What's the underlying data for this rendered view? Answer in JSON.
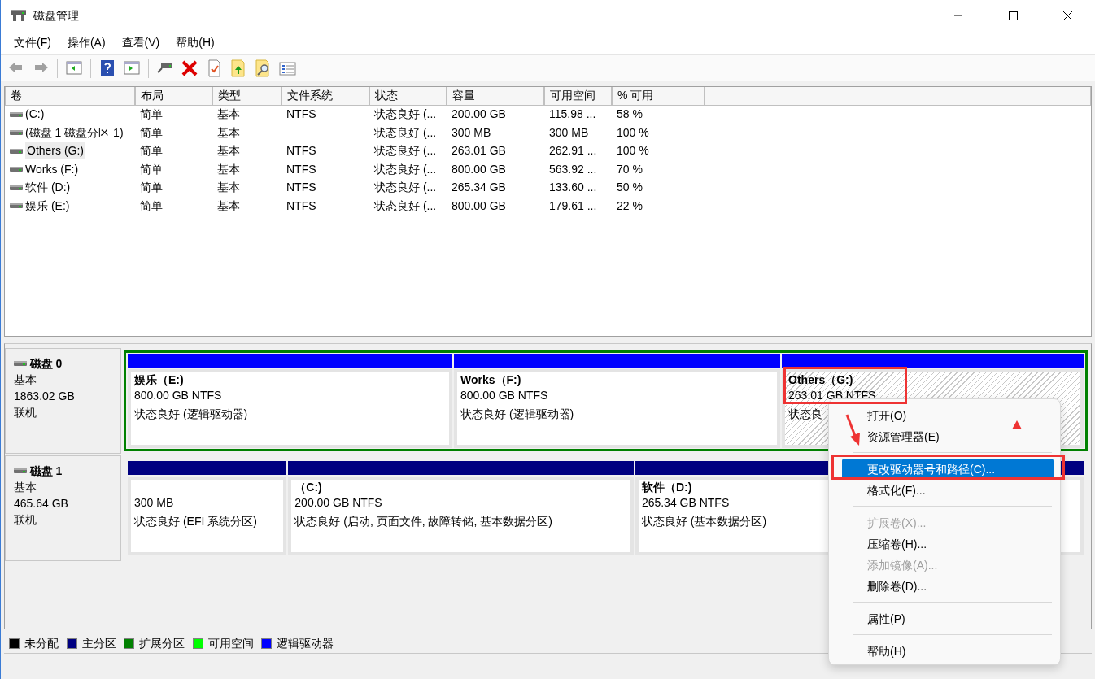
{
  "window": {
    "title": "磁盘管理"
  },
  "menu_bar": [
    "文件(F)",
    "操作(A)",
    "查看(V)",
    "帮助(H)"
  ],
  "toolbar": [
    {
      "kind": "back",
      "disabled": true
    },
    {
      "kind": "forward",
      "disabled": true
    },
    {
      "kind": "separator"
    },
    {
      "kind": "console-tree",
      "disabled": false
    },
    {
      "kind": "separator"
    },
    {
      "kind": "help",
      "disabled": false
    },
    {
      "kind": "action-pane",
      "disabled": false
    },
    {
      "kind": "separator"
    },
    {
      "kind": "connect",
      "disabled": false
    },
    {
      "kind": "delete",
      "disabled": false
    },
    {
      "kind": "checklist",
      "disabled": false
    },
    {
      "kind": "folder-up",
      "disabled": false
    },
    {
      "kind": "folder-search",
      "disabled": false
    },
    {
      "kind": "list",
      "disabled": false
    }
  ],
  "table": {
    "columns": [
      "卷",
      "布局",
      "类型",
      "文件系统",
      "状态",
      "容量",
      "可用空间",
      "% 可用"
    ],
    "rows": [
      {
        "selected": false,
        "cells": [
          "(C:)",
          "简单",
          "基本",
          "NTFS",
          "状态良好 (...",
          "200.00 GB",
          "115.98 ...",
          "58 %"
        ]
      },
      {
        "selected": false,
        "cells": [
          "(磁盘 1 磁盘分区 1)",
          "简单",
          "基本",
          "",
          "状态良好 (...",
          "300 MB",
          "300 MB",
          "100 %"
        ]
      },
      {
        "selected": true,
        "cells": [
          "Others (G:)",
          "简单",
          "基本",
          "NTFS",
          "状态良好 (...",
          "263.01 GB",
          "262.91 ...",
          "100 %"
        ]
      },
      {
        "selected": false,
        "cells": [
          "Works (F:)",
          "简单",
          "基本",
          "NTFS",
          "状态良好 (...",
          "800.00 GB",
          "563.92 ...",
          "70 %"
        ]
      },
      {
        "selected": false,
        "cells": [
          "软件 (D:)",
          "简单",
          "基本",
          "NTFS",
          "状态良好 (...",
          "265.34 GB",
          "133.60 ...",
          "50 %"
        ]
      },
      {
        "selected": false,
        "cells": [
          "娱乐 (E:)",
          "简单",
          "基本",
          "NTFS",
          "状态良好 (...",
          "800.00 GB",
          "179.61 ...",
          "22 %"
        ]
      }
    ]
  },
  "disks": [
    {
      "name": "磁盘 0",
      "type": "基本",
      "size": "1863.02 GB",
      "status": "联机",
      "extended": true,
      "partitions": [
        {
          "kind": "logical",
          "title": "娱乐（E:)",
          "size": "800.00 GB NTFS",
          "status": "状态良好 (逻辑驱动器)",
          "selected": false
        },
        {
          "kind": "logical",
          "title": "Works（F:)",
          "size": "800.00 GB NTFS",
          "status": "状态良好 (逻辑驱动器)",
          "selected": false
        },
        {
          "kind": "logical",
          "title": "Others（G:)",
          "size": "263.01 GB NTFS",
          "status": "状态良",
          "selected": true
        }
      ]
    },
    {
      "name": "磁盘 1",
      "type": "基本",
      "size": "465.64 GB",
      "status": "联机",
      "extended": false,
      "partitions": [
        {
          "kind": "primary",
          "size": "300 MB",
          "status": "状态良好 (EFI 系统分区)",
          "selected": false
        },
        {
          "kind": "primary",
          "title": "（C:)",
          "size": "200.00 GB NTFS",
          "status": "状态良好 (启动, 页面文件, 故障转储, 基本数据分区)",
          "selected": false
        },
        {
          "kind": "primary",
          "title": "软件（D:)",
          "size": "265.34 GB NTFS",
          "status": "状态良好 (基本数据分区)",
          "selected": false
        }
      ]
    }
  ],
  "legend": [
    {
      "label": "未分配",
      "color": "#000000"
    },
    {
      "label": "主分区",
      "color": "#000080"
    },
    {
      "label": "扩展分区",
      "color": "#008000"
    },
    {
      "label": "可用空间",
      "color": "#00ff00"
    },
    {
      "label": "逻辑驱动器",
      "color": "#0000ff"
    }
  ],
  "context_menu": {
    "items": [
      {
        "kind": "item",
        "label": "打开(O)",
        "disabled": false,
        "selected": false
      },
      {
        "kind": "item",
        "label": "资源管理器(E)",
        "disabled": false,
        "selected": false
      },
      {
        "kind": "separator"
      },
      {
        "kind": "item",
        "label": "更改驱动器号和路径(C)...",
        "disabled": false,
        "selected": true
      },
      {
        "kind": "item",
        "label": "格式化(F)...",
        "disabled": false,
        "selected": false
      },
      {
        "kind": "separator"
      },
      {
        "kind": "item",
        "label": "扩展卷(X)...",
        "disabled": true,
        "selected": false
      },
      {
        "kind": "item",
        "label": "压缩卷(H)...",
        "disabled": false,
        "selected": false
      },
      {
        "kind": "item",
        "label": "添加镜像(A)...",
        "disabled": true,
        "selected": false
      },
      {
        "kind": "item",
        "label": "删除卷(D)...",
        "disabled": false,
        "selected": false
      },
      {
        "kind": "separator"
      },
      {
        "kind": "item",
        "label": "属性(P)",
        "disabled": false,
        "selected": false
      },
      {
        "kind": "separator"
      },
      {
        "kind": "item",
        "label": "帮助(H)",
        "disabled": false,
        "selected": false
      }
    ]
  }
}
